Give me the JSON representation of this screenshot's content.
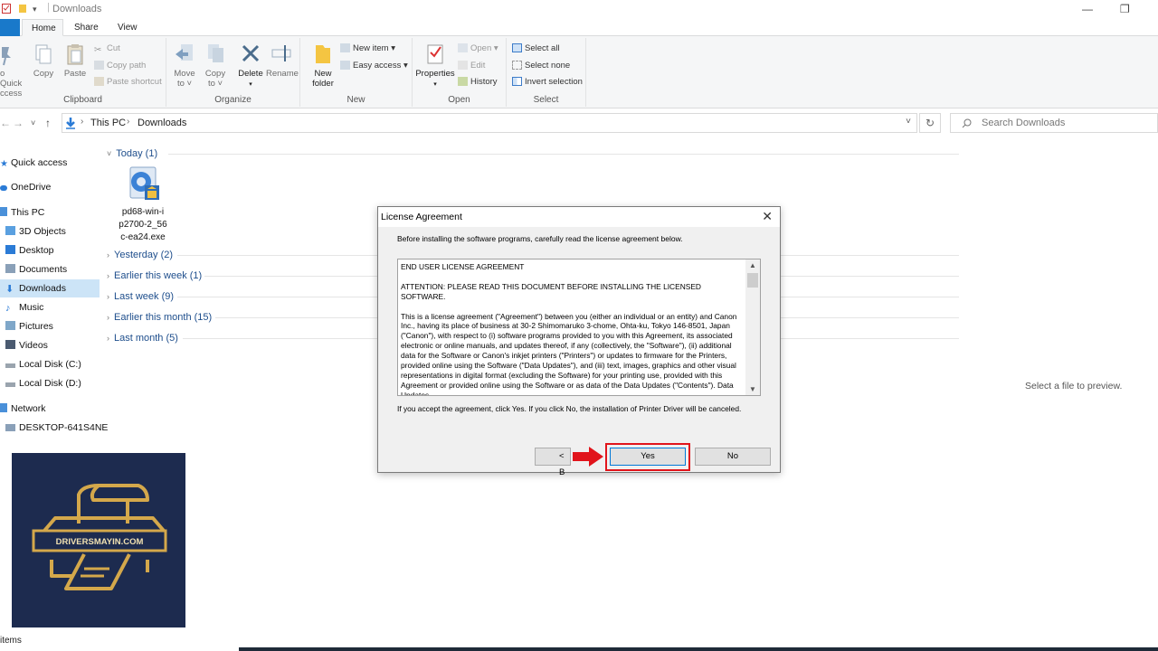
{
  "window": {
    "title": "Downloads"
  },
  "ribbon": {
    "tabs": [
      "Home",
      "Share",
      "View"
    ],
    "clipboard": {
      "pin_label_line1": "o Quick",
      "pin_label_line2": "ccess",
      "copy": "Copy",
      "paste": "Paste",
      "cut": "Cut",
      "copy_path": "Copy path",
      "paste_shortcut": "Paste shortcut",
      "group": "Clipboard"
    },
    "organize": {
      "move_to_line1": "Move",
      "move_to_line2": "to ˅",
      "copy_to_line1": "Copy",
      "copy_to_line2": "to ˅",
      "delete": "Delete",
      "rename": "Rename",
      "group": "Organize"
    },
    "new": {
      "new_folder_line1": "New",
      "new_folder_line2": "folder",
      "new_item": "New item ▾",
      "easy_access": "Easy access ▾",
      "group": "New"
    },
    "open": {
      "properties": "Properties",
      "open": "Open ▾",
      "edit": "Edit",
      "history": "History",
      "group": "Open"
    },
    "select": {
      "select_all": "Select all",
      "select_none": "Select none",
      "invert_selection": "Invert selection",
      "group": "Select"
    }
  },
  "address": {
    "crumbs": [
      "This PC",
      "Downloads"
    ],
    "search_placeholder": "Search Downloads"
  },
  "nav": {
    "items": [
      {
        "label": "Quick access"
      },
      {
        "label": "OneDrive"
      },
      {
        "label": "This PC"
      },
      {
        "label": "3D Objects"
      },
      {
        "label": "Desktop"
      },
      {
        "label": "Documents"
      },
      {
        "label": "Downloads"
      },
      {
        "label": "Music"
      },
      {
        "label": "Pictures"
      },
      {
        "label": "Videos"
      },
      {
        "label": "Local Disk (C:)"
      },
      {
        "label": "Local Disk (D:)"
      },
      {
        "label": "Network"
      },
      {
        "label": "DESKTOP-641S4NE"
      }
    ]
  },
  "content": {
    "groups": [
      "Today (1)",
      "Yesterday (2)",
      "Earlier this week (1)",
      "Last week (9)",
      "Earlier this month (15)",
      "Last month (5)"
    ],
    "file": {
      "line1": "pd68-win-i",
      "line2": "p2700-2_56",
      "line3": "c-ea24.exe"
    },
    "preview": "Select a file to preview."
  },
  "status": {
    "text": "items"
  },
  "dialog": {
    "title": "License Agreement",
    "intro": "Before installing the software programs, carefully read the license agreement below.",
    "license": {
      "heading": "END USER LICENSE AGREEMENT",
      "attention": "ATTENTION: PLEASE READ THIS DOCUMENT BEFORE INSTALLING THE LICENSED SOFTWARE.",
      "body": "This is a license agreement (\"Agreement\") between you (either an individual or an entity) and Canon Inc., having its place of business at 30-2 Shimomaruko 3-chome, Ohta-ku, Tokyo 146-8501, Japan (\"Canon\"), with respect to (i) software programs provided to you with this Agreement, its associated electronic or online manuals, and updates thereof, if any (collectively, the \"Software\"), (ii) additional data for the Software or Canon's inkjet printers (\"Printers\") or updates to firmware for the Printers, provided online using the Software (\"Data Updates\"), and (iii) text, images, graphics and other visual representations in digital format (excluding the Software) for your printing use, provided with this Agreement or provided online using the Software or as data of the Data Updates (\"Contents\"). Data Updates"
    },
    "note": "If you accept the agreement, click Yes. If you click No, the installation of Printer Driver will be canceled.",
    "back": "< B",
    "yes": "Yes",
    "no": "No"
  },
  "logo": {
    "text": "DRIVERSMAYIN.COM"
  },
  "colors": {
    "accent": "#1979ca",
    "highlight": "#e1141b",
    "logo_bg": "#1d2b4f",
    "logo_gold": "#d4a84b"
  }
}
